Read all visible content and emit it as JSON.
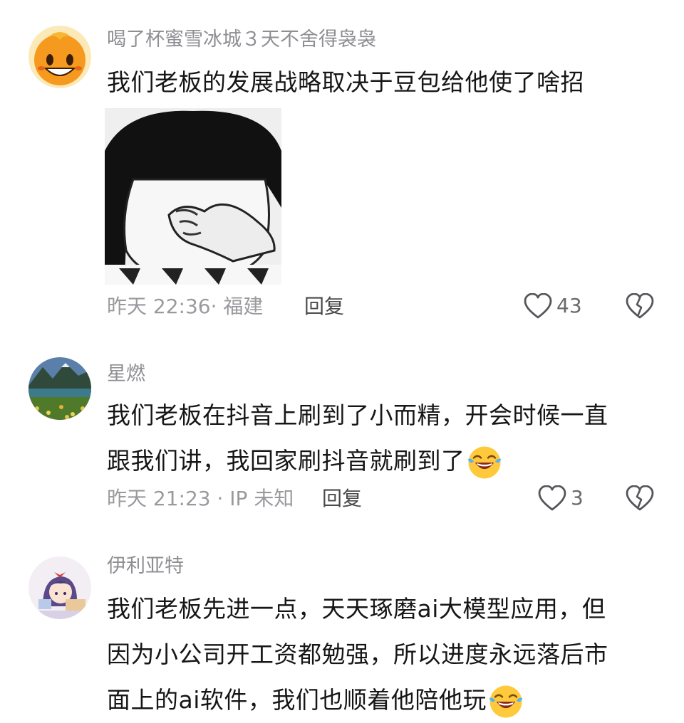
{
  "comments": [
    {
      "username": "喝了杯蜜雪冰城３天不舍得袅袅",
      "lines": [
        "我们老板的发展战略取决于豆包给他使了啥招"
      ],
      "time_location": "昨天 22:36· 福建",
      "reply_label": "回复",
      "likes": "43",
      "avatar_icon": "orange-smiley-avatar-icon",
      "sticker": "cartoon-sticker-facepalm"
    },
    {
      "username": "星燃",
      "lines": [
        "我们老板在抖音上刷到了小而精，开会时候一直",
        "跟我们讲，我回家刷抖音就刷到了"
      ],
      "time_location": "昨天 21:23 · IP 未知",
      "reply_label": "回复",
      "likes": "3",
      "avatar_icon": "landscape-lake-avatar-icon",
      "emoji": "laughing-crying-emoji"
    },
    {
      "username": "伊利亚特",
      "lines": [
        "我们老板先进一点，天天琢磨ai大模型应用，但",
        "因为小公司开工资都勉强，所以进度永远落后市",
        "面上的ai软件，我们也顺着他陪他玩"
      ],
      "avatar_icon": "anime-girl-avatar-icon",
      "emoji": "laughing-crying-emoji"
    }
  ],
  "colors": {
    "username": "#8e8e93",
    "body_text": "#161616",
    "meta": "#9a9a9e"
  }
}
